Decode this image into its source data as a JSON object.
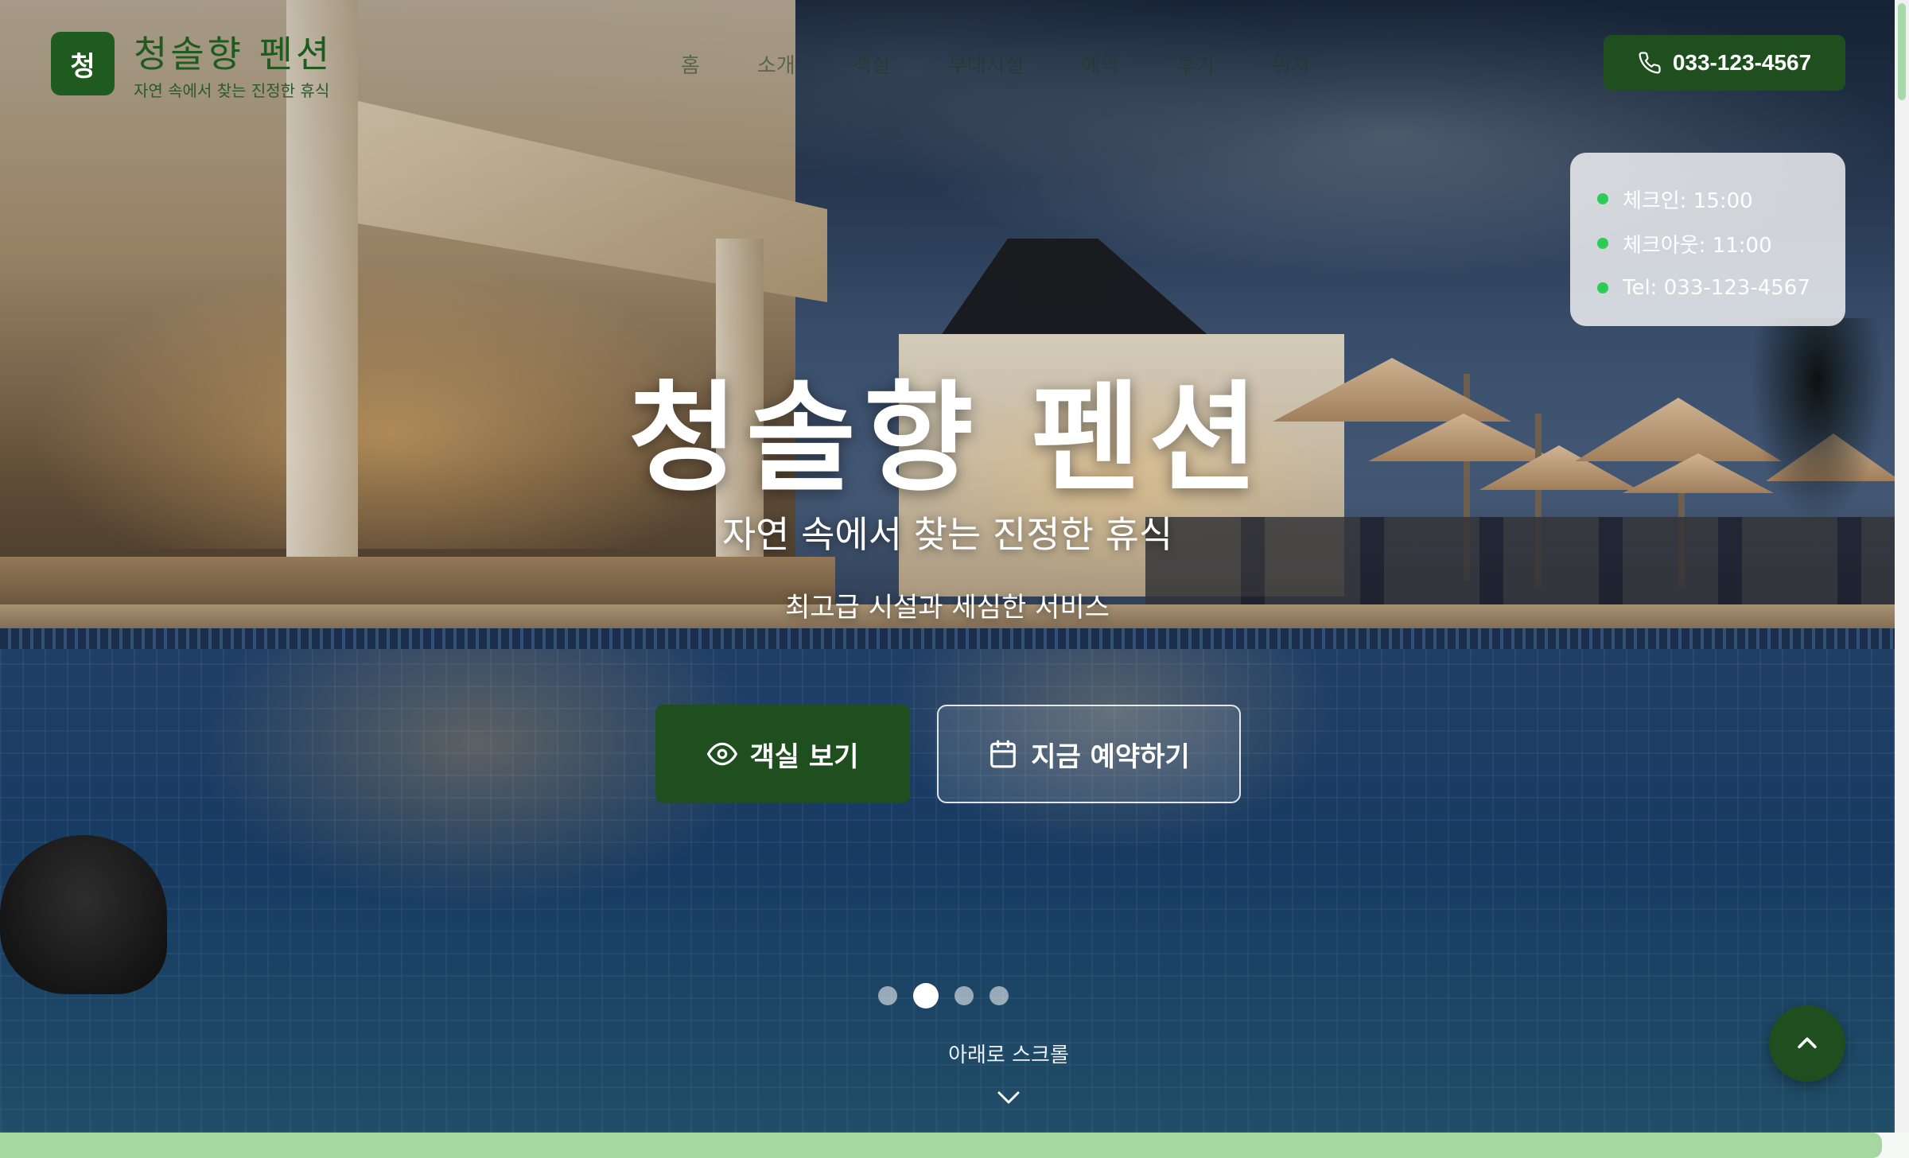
{
  "brand": {
    "logo_char": "청",
    "name": "청솔향 펜션",
    "tagline": "자연 속에서 찾는 진정한 휴식"
  },
  "nav": {
    "items": [
      "홈",
      "소개",
      "객실",
      "부대시설",
      "예약",
      "후기",
      "위치"
    ]
  },
  "header": {
    "phone_label": "033-123-4567",
    "phone_icon": "phone-icon"
  },
  "info_card": {
    "rows": [
      "체크인: 15:00",
      "체크아웃: 11:00",
      "Tel: 033-123-4567"
    ],
    "dot_color": "#2ecc55"
  },
  "hero": {
    "title": "청솔향 펜션",
    "subtitle": "자연 속에서 찾는 진정한 휴식",
    "subtitle2": "최고급 시설과 세심한 서비스",
    "primary_button": "객실 보기",
    "primary_icon": "eye-icon",
    "secondary_button": "지금 예약하기",
    "secondary_icon": "calendar-icon"
  },
  "slider": {
    "count": 4,
    "active_index": 1
  },
  "scroll_hint": {
    "label": "아래로 스크롤",
    "icon": "chevron-down-icon"
  },
  "back_to_top": {
    "icon": "chevron-up-icon"
  },
  "colors": {
    "brand_green": "#1f4f1f",
    "accent_light_green": "#a4d8a0",
    "text_white": "#ffffff"
  }
}
